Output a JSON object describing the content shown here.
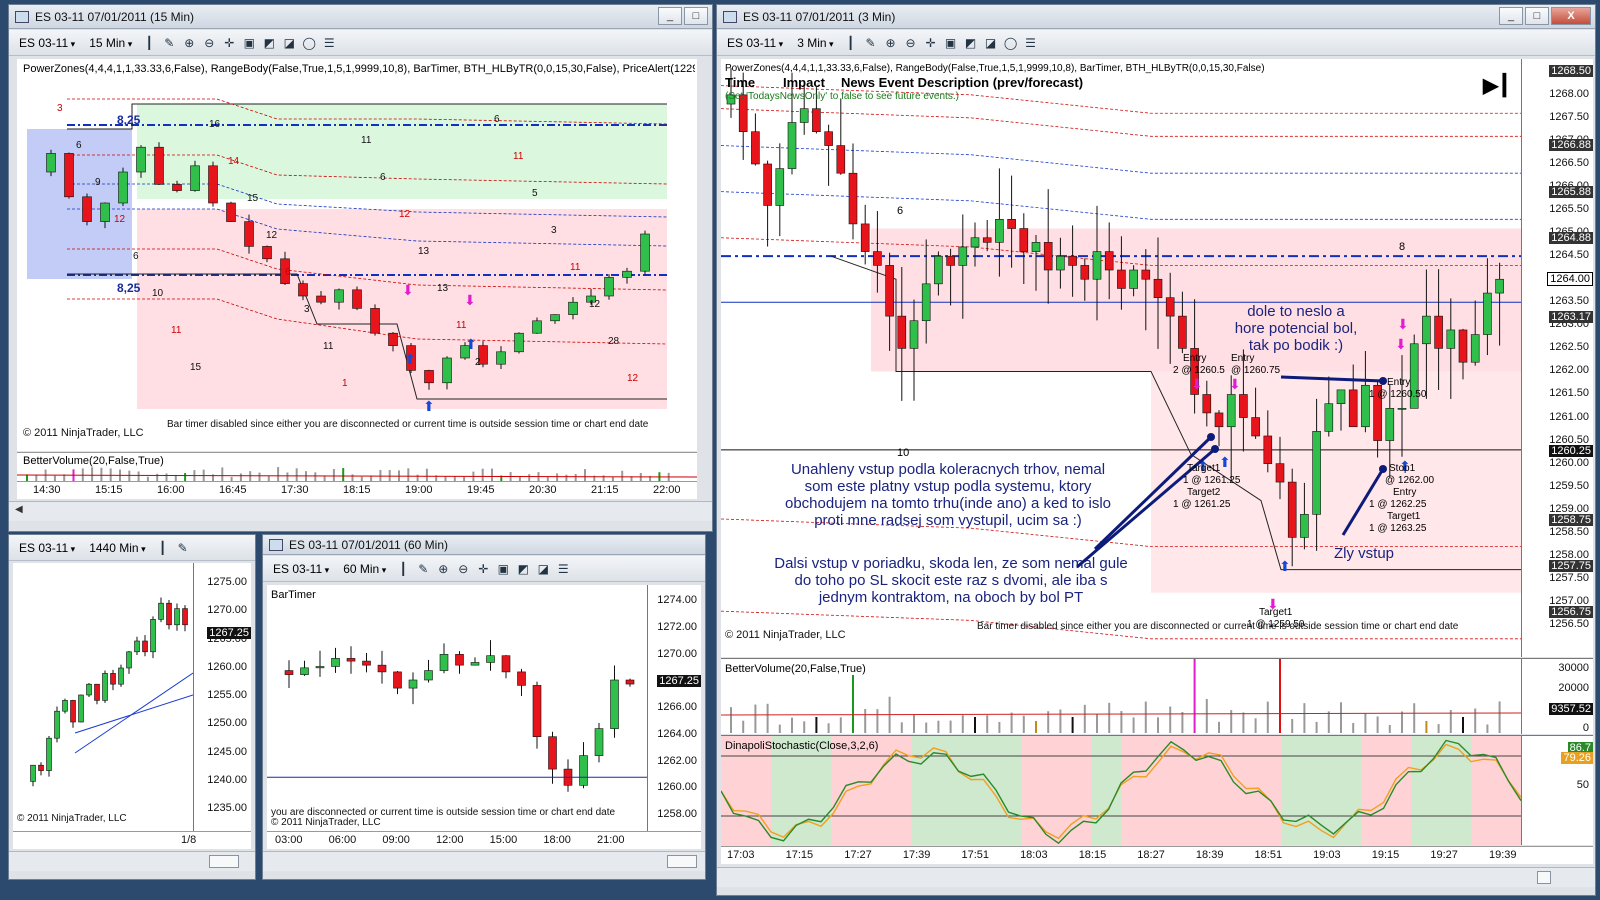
{
  "windows": {
    "w15": {
      "title": "ES 03-11  07/01/2011 (15 Min)",
      "instrument": "ES 03-11",
      "interval": "15 Min",
      "indicators": "PowerZones(4,4,4,1,1,33.33,6,False), RangeBody(False,True,1,5,1,9999,10,8), BarTimer, BTH_HLByTR(0,0,15,30,False), PriceAlert(1229",
      "copyright": "© 2011 NinjaTrader, LLC",
      "bartimer": "Bar timer disabled since either you are disconnected or current time is outside session time or chart end date",
      "subpanel": "BetterVolume(20,False,True)",
      "label_top": "8,25",
      "label_bottom": "8,25",
      "xticks": [
        "14:30",
        "15:15",
        "16:00",
        "16:45",
        "17:30",
        "18:15",
        "19:00",
        "19:45",
        "20:30",
        "21:15",
        "22:00"
      ],
      "marks": [
        "3",
        "6",
        "9",
        "12",
        "6",
        "10",
        "11",
        "15",
        "16",
        "14",
        "15",
        "12",
        "6",
        "3",
        "11",
        "1",
        "11",
        "6",
        "12",
        "13",
        "13",
        "11",
        "2",
        "6",
        "11",
        "5",
        "3",
        "11",
        "12",
        "28",
        "12"
      ]
    },
    "w1440": {
      "instrument": "ES 03-11",
      "interval": "1440 Min",
      "yticks": [
        "1275.00",
        "1270.00",
        "1265.00",
        "1260.00",
        "1255.00",
        "1250.00",
        "1245.00",
        "1240.00",
        "1235.00"
      ],
      "price_tag": "1267.25",
      "copyright": "© 2011 NinjaTrader, LLC",
      "xtick": "1/8"
    },
    "w60": {
      "title": "ES 03-11  07/01/2011 (60 Min)",
      "instrument": "ES 03-11",
      "interval": "60 Min",
      "indicator": "BarTimer",
      "yticks": [
        "1274.00",
        "1272.00",
        "1270.00",
        "1268.00",
        "1266.00",
        "1264.00",
        "1262.00",
        "1260.00",
        "1258.00"
      ],
      "price_tag": "1267.25",
      "bartimer": "you are disconnected or current time is outside session time or chart end date",
      "copyright": "© 2011 NinjaTrader, LLC",
      "xticks": [
        "03:00",
        "06:00",
        "09:00",
        "12:00",
        "15:00",
        "18:00",
        "21:00"
      ]
    },
    "w3": {
      "title": "ES 03-11  07/01/2011 (3 Min)",
      "instrument": "ES 03-11",
      "interval": "3 Min",
      "indicators": "PowerZones(4,4,4,1,1,33.33,6,False), RangeBody(False,True,1,5,1,9999,10,8), BarTimer, BTH_HLByTR(0,0,15,30,False)",
      "news_header": [
        "Time",
        "Impact",
        "News Event Description (prev/forecast)"
      ],
      "news_hint": "(Set 'TodaysNewsOnly' to false to see future events.)",
      "yticks": [
        "1268.00",
        "1267.50",
        "1267.00",
        "1266.50",
        "1266.00",
        "1265.50",
        "1265.00",
        "1264.50",
        "1264.00",
        "1263.50",
        "1263.00",
        "1262.50",
        "1262.00",
        "1261.50",
        "1261.00",
        "1260.50",
        "1260.00",
        "1259.50",
        "1259.00",
        "1258.50",
        "1258.00",
        "1257.50",
        "1257.00",
        "1256.50"
      ],
      "price_tags": [
        "1268.50",
        "1266.88",
        "1265.88",
        "1264.88",
        "1264.00",
        "1263.17",
        "1260.25",
        "1258.75",
        "1257.75",
        "1256.75"
      ],
      "copyright": "© 2011 NinjaTrader, LLC",
      "bartimer": "Bar timer disabled since either you are disconnected or current time is outside session time or chart end date",
      "vol_label": "BetterVolume(20,False,True)",
      "vol_ticks": [
        "30000",
        "20000",
        "10000",
        "0"
      ],
      "vol_tag": "9357.52",
      "stoch_label": "DinapoliStochastic(Close,3,2,6)",
      "stoch_ticks": [
        "50"
      ],
      "stoch_tags": [
        "86.7",
        "79.26"
      ],
      "xticks": [
        "17:03",
        "17:15",
        "17:27",
        "17:39",
        "17:51",
        "18:03",
        "18:15",
        "18:27",
        "18:39",
        "18:51",
        "19:03",
        "19:15",
        "19:27",
        "19:39"
      ],
      "num6": "6",
      "num8": "8",
      "num10": "10",
      "orders": {
        "entry1": "Entry",
        "entry1b": "2 @ 1260.5",
        "entry2": "Entry",
        "entry2b": "@ 1260.75",
        "target1": "Target1",
        "target1b": "1 @ 1261.25",
        "target2": "Target2",
        "target2b": "1 @ 1261.25",
        "target3": "Target1",
        "target3b": "1 @ 1259.50",
        "entry3": "Entry",
        "entry3b": "1 @ 1260.50",
        "stop1": "Stop1",
        "stop1b": "@ 1262.00",
        "entry4": "Entry",
        "entry4b": "1 @ 1262.25",
        "target4": "Target1",
        "target4b": "1 @ 1263.25"
      },
      "notes": {
        "n1": "dole to neslo a hore potencial bol, tak po bodik :)",
        "n2": "Unahleny vstup podla koleracnych trhov, nemal som este platny vstup podla systemu, ktory obchodujem na tomto trhu(inde ano) a ked to islo proti mne radsej som vystupil, ucim sa :)",
        "n3": "Dalsi vstup v poriadku, skoda len, ze som nemal gule do toho po SL skocit este raz s dvomi, ale iba s jednym kontraktom, na oboch by bol PT",
        "n4": "Zly vstup"
      }
    }
  },
  "window_buttons": {
    "minimize": "_",
    "maximize": "□",
    "close": "X"
  },
  "colors": {
    "up": "#2fbf4a",
    "down": "#e8141b",
    "zone_pink": "#ffd7dc",
    "zone_green": "#d7f7dc",
    "zone_blue": "#a9b6f2"
  }
}
